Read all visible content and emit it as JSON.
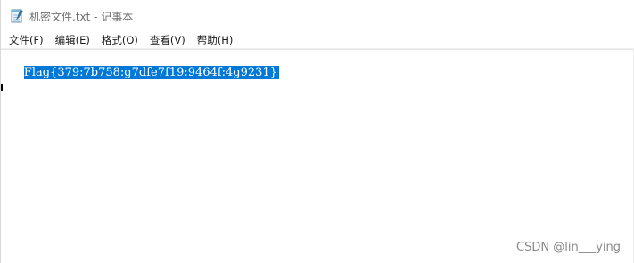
{
  "window": {
    "title": "机密文件.txt - 记事本",
    "icon": "notepad-icon"
  },
  "menu": {
    "items": [
      {
        "label": "文件(F)"
      },
      {
        "label": "编辑(E)"
      },
      {
        "label": "格式(O)"
      },
      {
        "label": "查看(V)"
      },
      {
        "label": "帮助(H)"
      }
    ]
  },
  "editor": {
    "selected_text": "Flag{379:7b758:g7dfe7f19:9464f:4g9231}",
    "selection_color": "#0078d7"
  },
  "watermark": {
    "text": "CSDN @lin___ying"
  }
}
